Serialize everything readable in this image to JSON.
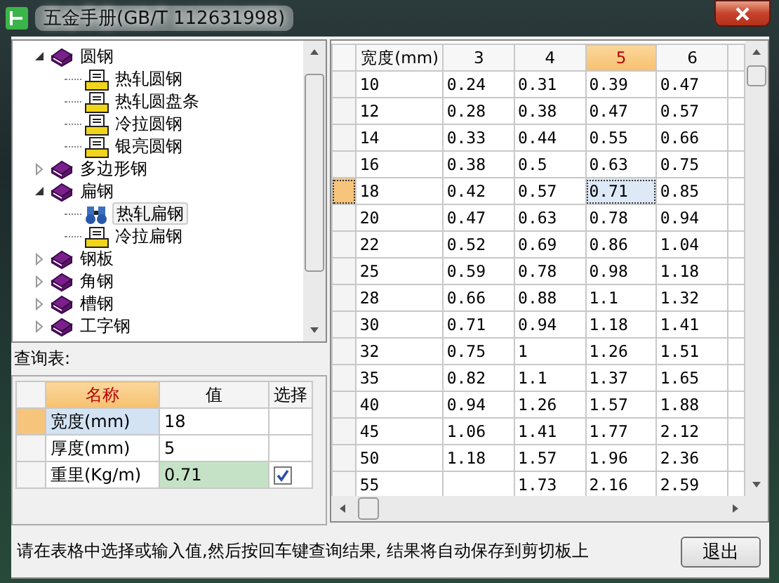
{
  "window": {
    "title": "五金手册(GB/T 112631998)"
  },
  "tree": {
    "items": [
      {
        "label": "圆钢",
        "expanded": true,
        "selected": false,
        "children": [
          {
            "label": "热轧圆钢",
            "selected": false
          },
          {
            "label": "热轧圆盘条",
            "selected": false
          },
          {
            "label": "冷拉圆钢",
            "selected": false
          },
          {
            "label": "银亮圆钢",
            "selected": false
          }
        ]
      },
      {
        "label": "多边形钢",
        "expanded": false,
        "selected": false
      },
      {
        "label": "扁钢",
        "expanded": true,
        "selected": false,
        "children": [
          {
            "label": "热轧扁钢",
            "selected": true
          },
          {
            "label": "冷拉扁钢",
            "selected": false
          }
        ]
      },
      {
        "label": "钢板",
        "expanded": false,
        "selected": false
      },
      {
        "label": "角钢",
        "expanded": false,
        "selected": false
      },
      {
        "label": "槽钢",
        "expanded": false,
        "selected": false
      },
      {
        "label": "工字钢",
        "expanded": false,
        "selected": false
      }
    ]
  },
  "query": {
    "label": "查询表:",
    "columns": [
      {
        "label": "名称",
        "selected": true
      },
      {
        "label": "值",
        "selected": false
      },
      {
        "label": "选择",
        "selected": false
      }
    ],
    "rows": [
      {
        "kind": "input",
        "name": "宽度(mm)",
        "value": "18",
        "selected": true
      },
      {
        "kind": "input",
        "name": "厚度(mm)",
        "value": "5",
        "selected": false
      },
      {
        "kind": "result",
        "name": "重里(Kg/m)",
        "value": "0.71",
        "selected": false,
        "checked": true
      }
    ]
  },
  "grid": {
    "columns": [
      {
        "label": "宽度(mm)",
        "selected": false
      },
      {
        "label": "3",
        "selected": false
      },
      {
        "label": "4",
        "selected": false
      },
      {
        "label": "5",
        "selected": true
      },
      {
        "label": "6",
        "selected": false
      }
    ],
    "rows": [
      {
        "cells": [
          "10",
          "0.24",
          "0.31",
          "0.39",
          "0.47"
        ],
        "selected": false
      },
      {
        "cells": [
          "12",
          "0.28",
          "0.38",
          "0.47",
          "0.57"
        ],
        "selected": false
      },
      {
        "cells": [
          "14",
          "0.33",
          "0.44",
          "0.55",
          "0.66"
        ],
        "selected": false
      },
      {
        "cells": [
          "16",
          "0.38",
          "0.5",
          "0.63",
          "0.75"
        ],
        "selected": false
      },
      {
        "cells": [
          "18",
          "0.42",
          "0.57",
          "0.71",
          "0.85"
        ],
        "selected": true
      },
      {
        "cells": [
          "20",
          "0.47",
          "0.63",
          "0.78",
          "0.94"
        ],
        "selected": false
      },
      {
        "cells": [
          "22",
          "0.52",
          "0.69",
          "0.86",
          "1.04"
        ],
        "selected": false
      },
      {
        "cells": [
          "25",
          "0.59",
          "0.78",
          "0.98",
          "1.18"
        ],
        "selected": false
      },
      {
        "cells": [
          "28",
          "0.66",
          "0.88",
          "1.1",
          "1.32"
        ],
        "selected": false
      },
      {
        "cells": [
          "30",
          "0.71",
          "0.94",
          "1.18",
          "1.41"
        ],
        "selected": false
      },
      {
        "cells": [
          "32",
          "0.75",
          "1",
          "1.26",
          "1.51"
        ],
        "selected": false
      },
      {
        "cells": [
          "35",
          "0.82",
          "1.1",
          "1.37",
          "1.65"
        ],
        "selected": false
      },
      {
        "cells": [
          "40",
          "0.94",
          "1.26",
          "1.57",
          "1.88"
        ],
        "selected": false
      },
      {
        "cells": [
          "45",
          "1.06",
          "1.41",
          "1.77",
          "2.12"
        ],
        "selected": false
      },
      {
        "cells": [
          "50",
          "1.18",
          "1.57",
          "1.96",
          "2.36"
        ],
        "selected": false
      },
      {
        "cells": [
          "55",
          "",
          "1.73",
          "2.16",
          "2.59"
        ],
        "selected": false
      }
    ]
  },
  "status_bar": {
    "message": "请在表格中选择或输入值,然后按回车键查询结果, 结果将自动保存到剪切板上",
    "button": "退出"
  }
}
